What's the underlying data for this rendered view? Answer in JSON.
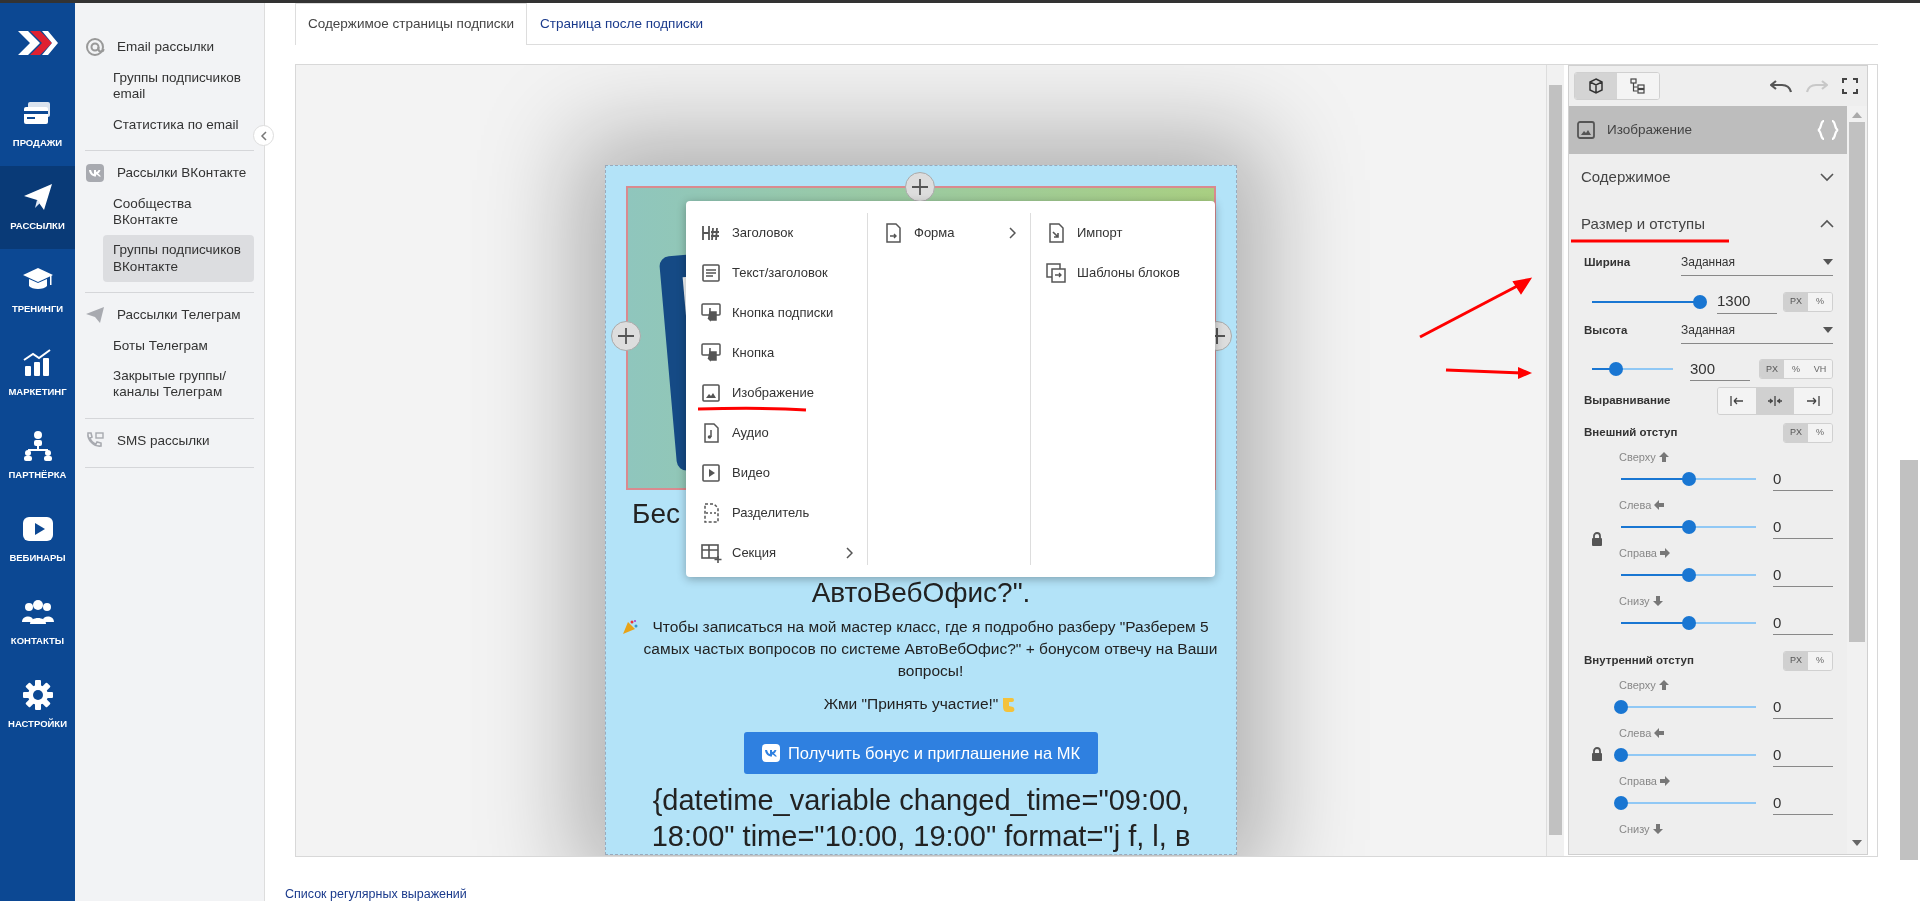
{
  "rail": {
    "items": [
      {
        "label": "ПРОДАЖИ",
        "selected": false
      },
      {
        "label": "РАССЫЛКИ",
        "selected": true
      },
      {
        "label": "ТРЕНИНГИ",
        "selected": false
      },
      {
        "label": "МАРКЕТИНГ",
        "selected": false
      },
      {
        "label": "ПАРТНЁРКА",
        "selected": false
      },
      {
        "label": "ВЕБИНАРЫ",
        "selected": false
      },
      {
        "label": "КОНТАКТЫ",
        "selected": false
      },
      {
        "label": "НАСТРОЙКИ",
        "selected": false
      }
    ]
  },
  "subnav": {
    "groups": [
      {
        "title": "Email рассылки",
        "items": [
          {
            "label": "Группы подписчиков email",
            "selected": false
          },
          {
            "label": "Статистика по email",
            "selected": false
          }
        ]
      },
      {
        "title": "Рассылки ВКонтакте",
        "items": [
          {
            "label": "Сообщества ВКонтакте",
            "selected": false
          },
          {
            "label": "Группы подписчиков ВКонтакте",
            "selected": true
          }
        ]
      },
      {
        "title": "Рассылки Телеграм",
        "items": [
          {
            "label": "Боты Телеграм",
            "selected": false
          },
          {
            "label": "Закрытые группы/ каналы Телеграм",
            "selected": false
          }
        ]
      },
      {
        "title": "SMS рассылки"
      }
    ]
  },
  "tabs": [
    {
      "label": "Содержимое страницы подписки",
      "selected": true
    },
    {
      "label": "Страница после подписки",
      "selected": false
    }
  ],
  "canvas": {
    "heading_lines": [
      "Бес",
      "АвтоВебОфис?\"."
    ],
    "paragraph": "Чтобы записаться на мой мастер класс, где я подробно разберу \"Разберем 5 самых частых вопросов по системе АвтоВебОфис?\" + бонусом отвечу на Ваши вопросы!",
    "call_to_action": "Жми \"Принять участие!\"",
    "button": "Получить бонус и приглашение на МК",
    "variable_lines": [
      "{datetime_variable changed_time=\"09:00,",
      "18:00\" time=\"10:00, 19:00\" format=\"j f, l, в"
    ]
  },
  "insert_menu": {
    "columns": [
      [
        {
          "label": "Заголовок",
          "submenu": false
        },
        {
          "label": "Текст/заголовок",
          "submenu": false
        },
        {
          "label": "Кнопка подписки",
          "submenu": false
        },
        {
          "label": "Кнопка",
          "submenu": false
        },
        {
          "label": "Изображение",
          "submenu": false
        },
        {
          "label": "Аудио",
          "submenu": false
        },
        {
          "label": "Видео",
          "submenu": false
        },
        {
          "label": "Разделитель",
          "submenu": false
        },
        {
          "label": "Секция",
          "submenu": true
        }
      ],
      [
        {
          "label": "Форма",
          "submenu": true
        }
      ],
      [
        {
          "label": "Импорт",
          "submenu": false
        },
        {
          "label": "Шаблоны блоков",
          "submenu": false
        }
      ]
    ]
  },
  "panel": {
    "view_tabs": [
      {
        "selected": true
      },
      {
        "selected": false
      }
    ],
    "history": {
      "undo_disabled": false,
      "redo_disabled": true
    },
    "block_title": "Изображение",
    "sections": [
      {
        "title": "Содержимое",
        "expanded": false
      },
      {
        "title": "Размер и отступы",
        "expanded": true
      }
    ],
    "width": {
      "label": "Ширина",
      "mode": "Заданная",
      "level": 1,
      "value": "1300",
      "units": [
        {
          "label": "PX",
          "selected": true
        },
        {
          "label": "%",
          "selected": false
        }
      ]
    },
    "height": {
      "label": "Высота",
      "mode": "Заданная",
      "level": 0.3,
      "value": "300",
      "units": [
        {
          "label": "PX",
          "selected": true
        },
        {
          "label": "%",
          "selected": false
        },
        {
          "label": "VH",
          "selected": false
        }
      ]
    },
    "align": {
      "label": "Выравнивание",
      "options": [
        {
          "selected": false
        },
        {
          "selected": true
        },
        {
          "selected": false
        }
      ]
    },
    "spacings": [
      {
        "label": "Внешний отступ",
        "locked": true,
        "units": [
          {
            "label": "PX",
            "selected": true
          },
          {
            "label": "%",
            "selected": false
          }
        ],
        "sides": [
          {
            "label": "Сверху",
            "level": 0.5,
            "value": "0"
          },
          {
            "label": "Слева",
            "level": 0.5,
            "value": "0"
          },
          {
            "label": "Справа",
            "level": 0.5,
            "value": "0"
          },
          {
            "label": "Снизу",
            "level": 0.5,
            "value": "0"
          }
        ]
      },
      {
        "label": "Внутренний отступ",
        "locked": true,
        "units": [
          {
            "label": "PX",
            "selected": true
          },
          {
            "label": "%",
            "selected": false
          }
        ],
        "sides": [
          {
            "label": "Сверху",
            "level": 0,
            "value": "0"
          },
          {
            "label": "Слева",
            "level": 0,
            "value": "0"
          },
          {
            "label": "Справа",
            "level": 0,
            "value": "0"
          },
          {
            "label": "Снизу"
          }
        ]
      }
    ]
  },
  "footer_link": "Список регулярных выражений"
}
